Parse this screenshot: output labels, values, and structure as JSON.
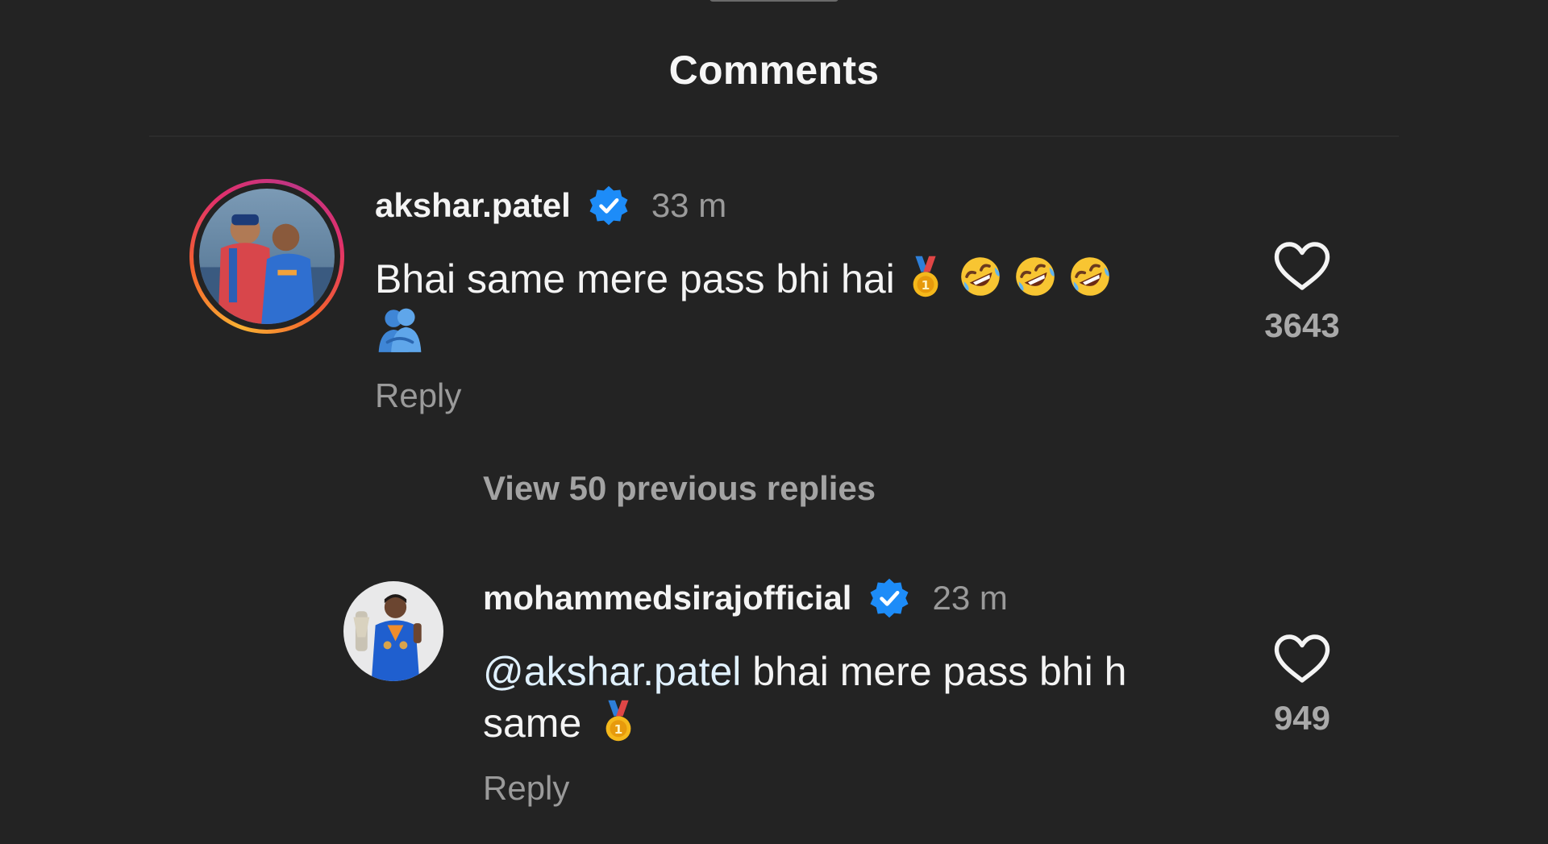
{
  "sheet": {
    "title": "Comments"
  },
  "comments": [
    {
      "username": "akshar.patel",
      "verified": true,
      "timestamp": "33 m",
      "text": "Bhai same mere pass bhi hai",
      "emojis": [
        "medal-icon",
        "rofl-icon",
        "rofl-icon",
        "rofl-icon",
        "hug-icon"
      ],
      "reply_label": "Reply",
      "like_count": "3643",
      "has_story": true
    },
    {
      "username": "mohammedsirajofficial",
      "verified": true,
      "timestamp": "23 m",
      "mention": "@akshar.patel",
      "text_line1": " bhai mere pass bhi h",
      "text_line2": "same",
      "emojis": [
        "medal-icon"
      ],
      "reply_label": "Reply",
      "like_count": "949",
      "has_story": false
    }
  ],
  "replies_toggle": {
    "label": "View 50 previous replies"
  },
  "colors": {
    "background": "#232323",
    "verified_badge": "#1d8cf8",
    "secondary_text": "#9a9a9a"
  }
}
